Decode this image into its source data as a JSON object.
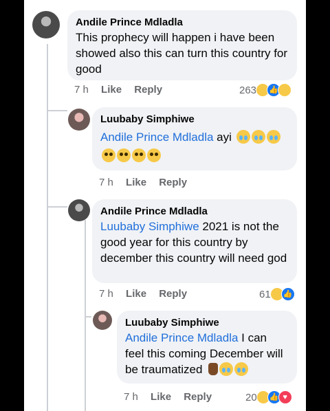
{
  "comments": [
    {
      "author": "Andile Prince Mdladla",
      "text": "This prophecy will happen i have been showed also this can turn this country for good",
      "time": "7 h",
      "like": "Like",
      "reply": "Reply",
      "reaction_count": "263",
      "reaction_icons": [
        "sad-icon",
        "like-icon",
        "wow-icon"
      ]
    },
    {
      "author": "Luubaby Simphiwe",
      "mention": "Andile Prince Mdladla",
      "text": "ayi",
      "emoji": [
        "crying-face-icon",
        "crying-face-icon",
        "crying-face-icon",
        "pleading-face-icon",
        "pleading-face-icon",
        "pleading-face-icon",
        "pleading-face-icon"
      ],
      "time": "7 h",
      "like": "Like",
      "reply": "Reply"
    },
    {
      "author": "Andile Prince Mdladla",
      "mention": "Luubaby Simphiwe",
      "text": "2021 is not the good year for this country by december this country will need god",
      "time": "7 h",
      "like": "Like",
      "reply": "Reply",
      "reaction_count": "61",
      "reaction_icons": [
        "sad-icon",
        "like-icon"
      ]
    },
    {
      "author": "Luubaby Simphiwe",
      "mention": "Andile Prince Mdladla",
      "text": "I can feel this coming December will be traumatized",
      "emoji": [
        "fingers-crossed-icon",
        "crying-face-icon",
        "crying-face-icon"
      ],
      "time": "7 h",
      "like": "Like",
      "reply": "Reply",
      "reaction_count": "20",
      "reaction_icons": [
        "sad-icon",
        "like-icon",
        "love-icon"
      ]
    }
  ]
}
